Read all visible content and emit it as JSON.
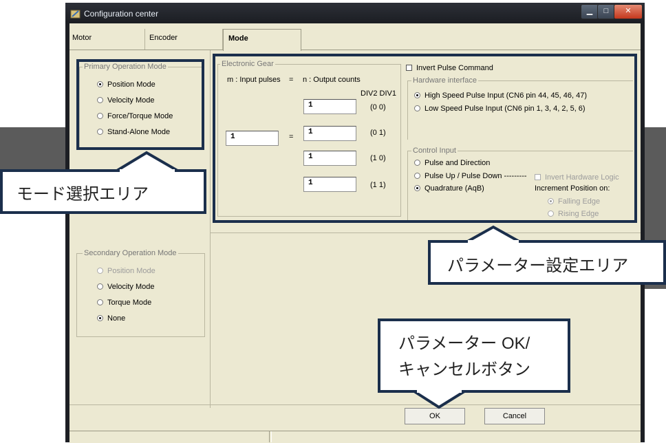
{
  "window": {
    "title": "Configuration center"
  },
  "tabs": [
    {
      "label": "Motor"
    },
    {
      "label": "Encoder"
    },
    {
      "label": "Mode"
    }
  ],
  "primary": {
    "legend": "Primary Operation Mode",
    "options": [
      "Position Mode",
      "Velocity Mode",
      "Force/Torque Mode",
      "Stand-Alone Mode"
    ],
    "selected": "Position Mode"
  },
  "secondary": {
    "legend": "Secondary Operation Mode",
    "options": [
      "Position Mode",
      "Velocity Mode",
      "Torque Mode",
      "None"
    ],
    "selected": "None"
  },
  "gear": {
    "legend": "Electronic Gear",
    "formula_left": "m : Input pulses",
    "eq": "=",
    "formula_right": "n : Output counts",
    "div_header": "DIV2 DIV1",
    "m_value": "1",
    "rows": [
      {
        "value": "1",
        "code": "(0 0)"
      },
      {
        "value": "1",
        "code": "(0 1)"
      },
      {
        "value": "1",
        "code": "(1 0)"
      },
      {
        "value": "1",
        "code": "(1 1)"
      }
    ]
  },
  "pulse": {
    "invert_label": "Invert Pulse Command",
    "hw_legend": "Hardware interface",
    "hw_options": [
      "High Speed Pulse Input (CN6 pin 44, 45, 46, 47)",
      "Low Speed Pulse Input (CN6 pin 1, 3, 4, 2, 5, 6)"
    ],
    "hw_selected": "High Speed Pulse Input (CN6 pin 44, 45, 46, 47)",
    "ctrl_legend": "Control Input",
    "ctrl_options": [
      "Pulse and Direction",
      "Pulse Up / Pulse Down ---------",
      "Quadrature (AqB)"
    ],
    "ctrl_selected": "Quadrature (AqB)",
    "invert_hw_label": "Invert Hardware Logic",
    "increment_label": "Increment Position on:",
    "edge_options": [
      "Falling Edge",
      "Rising Edge"
    ],
    "edge_selected": "Falling Edge"
  },
  "buttons": {
    "ok": "OK",
    "cancel": "Cancel"
  },
  "callouts": {
    "mode_area": "モード選択エリア",
    "param_area": "パラメーター設定エリア",
    "ok_cancel_line1": "パラメーター OK/",
    "ok_cancel_line2": "キャンセルボタン"
  },
  "colors": {
    "annotation": "#1b2f4c",
    "panel": "#ece9d2",
    "titlebar": "#1b1d22"
  }
}
